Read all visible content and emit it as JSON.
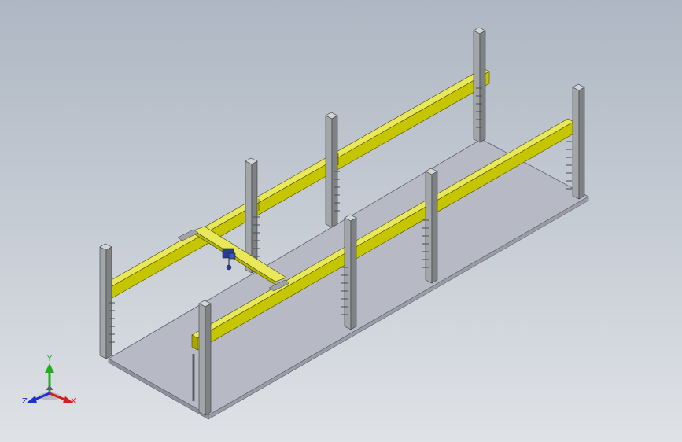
{
  "viewport": {
    "background_top": "#aeb7c3",
    "background_bottom": "#dfe2e6"
  },
  "model": {
    "description_icon": "overhead-crane-assembly",
    "beam_color": "#c8c800",
    "column_color": "#a6a9ac",
    "floor_color": "#b7b9c4",
    "hoist_color": "#2a3f8a"
  },
  "triad": {
    "x_label": "X",
    "y_label": "Y",
    "z_label": "Z",
    "x_color": "#d41e1e",
    "y_color": "#1fae1f",
    "z_color": "#1e2fd4"
  }
}
